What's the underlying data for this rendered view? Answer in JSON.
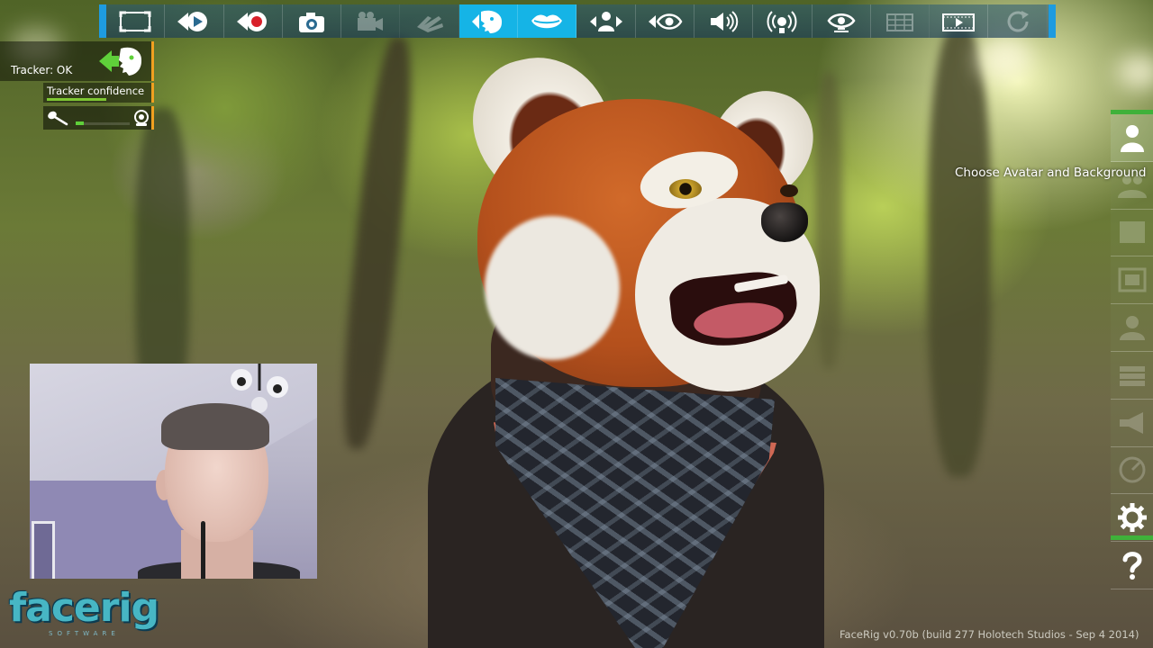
{
  "app": {
    "name": "FaceRig"
  },
  "toolbar": {
    "buttons": [
      {
        "icon": "fullscreen-icon",
        "state": "normal"
      },
      {
        "icon": "play-icon",
        "state": "normal"
      },
      {
        "icon": "record-icon",
        "state": "normal"
      },
      {
        "icon": "camera-icon",
        "state": "normal"
      },
      {
        "icon": "video-camera-icon",
        "state": "disabled"
      },
      {
        "icon": "hand-icon",
        "state": "disabled"
      },
      {
        "icon": "face-tracking-icon",
        "state": "active"
      },
      {
        "icon": "lips-icon",
        "state": "active"
      },
      {
        "icon": "avatar-arrows-icon",
        "state": "normal"
      },
      {
        "icon": "eye-arrow-icon",
        "state": "normal"
      },
      {
        "icon": "speaker-icon",
        "state": "normal"
      },
      {
        "icon": "broadcast-icon",
        "state": "normal"
      },
      {
        "icon": "eye-broadcast-icon",
        "state": "normal"
      },
      {
        "icon": "film-grid-icon",
        "state": "disabled"
      },
      {
        "icon": "film-play-icon",
        "state": "normal"
      },
      {
        "icon": "refresh-icon",
        "state": "disabled"
      }
    ]
  },
  "tracker": {
    "status": "Tracker: OK",
    "confidence_label": "Tracker confidence",
    "confidence_level": 0.6,
    "audio_level": 0.15
  },
  "side_menu": {
    "tooltip": "Choose Avatar and Background",
    "items": [
      {
        "icon": "avatar-icon",
        "state": "active"
      },
      {
        "icon": "avatar-group-icon",
        "state": "dim"
      },
      {
        "icon": "background-icon",
        "state": "dim"
      },
      {
        "icon": "frame-icon",
        "state": "dim"
      },
      {
        "icon": "people-settings-icon",
        "state": "dim"
      },
      {
        "icon": "layers-icon",
        "state": "dim"
      },
      {
        "icon": "megaphone-icon",
        "state": "dim"
      },
      {
        "icon": "gauge-icon",
        "state": "dim"
      },
      {
        "icon": "gear-icon",
        "state": "normal"
      },
      {
        "icon": "help-icon",
        "state": "normal"
      }
    ]
  },
  "logo": {
    "word": "facerig",
    "sub": "SOFTWARE"
  },
  "footer": {
    "version": "FaceRig v0.70b (build 277 Holotech Studios - Sep  4 2014)"
  },
  "colors": {
    "toolbar_accent": "#1e9be0",
    "toolbar_active": "#15b4e6",
    "side_accent": "#3fb13a",
    "tracker_accent": "#f0a020",
    "tracker_green": "#7ec832"
  }
}
